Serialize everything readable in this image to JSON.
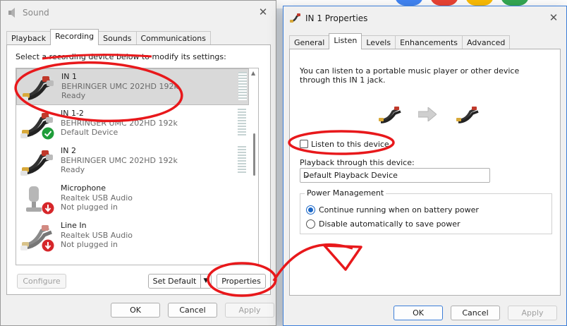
{
  "sound_window": {
    "title": "Sound",
    "tabs": [
      {
        "label": "Playback"
      },
      {
        "label": "Recording"
      },
      {
        "label": "Sounds"
      },
      {
        "label": "Communications"
      }
    ],
    "instruction": "Select a recording device below to modify its settings:",
    "devices": [
      {
        "name": "IN 1",
        "driver": "BEHRINGER UMC 202HD 192k",
        "status": "Ready"
      },
      {
        "name": "IN 1-2",
        "driver": "BEHRINGER UMC 202HD 192k",
        "status": "Default Device"
      },
      {
        "name": "IN 2",
        "driver": "BEHRINGER UMC 202HD 192k",
        "status": "Ready"
      },
      {
        "name": "Microphone",
        "driver": "Realtek USB Audio",
        "status": "Not plugged in"
      },
      {
        "name": "Line In",
        "driver": "Realtek USB Audio",
        "status": "Not plugged in"
      }
    ],
    "buttons": {
      "configure": "Configure",
      "set_default": "Set Default",
      "properties": "Properties",
      "ok": "OK",
      "cancel": "Cancel",
      "apply": "Apply"
    }
  },
  "props_window": {
    "title": "IN 1 Properties",
    "tabs": [
      {
        "label": "General"
      },
      {
        "label": "Listen"
      },
      {
        "label": "Levels"
      },
      {
        "label": "Enhancements"
      },
      {
        "label": "Advanced"
      }
    ],
    "description": "You can listen to a portable music player or other device through this IN 1 jack.",
    "listen_checkbox": {
      "label": "Listen to this device",
      "checked": false
    },
    "playback_label": "Playback through this device:",
    "playback_selected": "Default Playback Device",
    "power_group": {
      "title": "Power Management",
      "options": [
        {
          "label": "Continue running when on battery power",
          "selected": true
        },
        {
          "label": "Disable automatically to save power",
          "selected": false
        }
      ]
    },
    "buttons": {
      "ok": "OK",
      "cancel": "Cancel",
      "apply": "Apply"
    }
  },
  "colors": {
    "annotation": "#e8181b",
    "accent": "#1a66c6",
    "default_check": "#1f9d3a",
    "unplugged": "#d6262a"
  }
}
